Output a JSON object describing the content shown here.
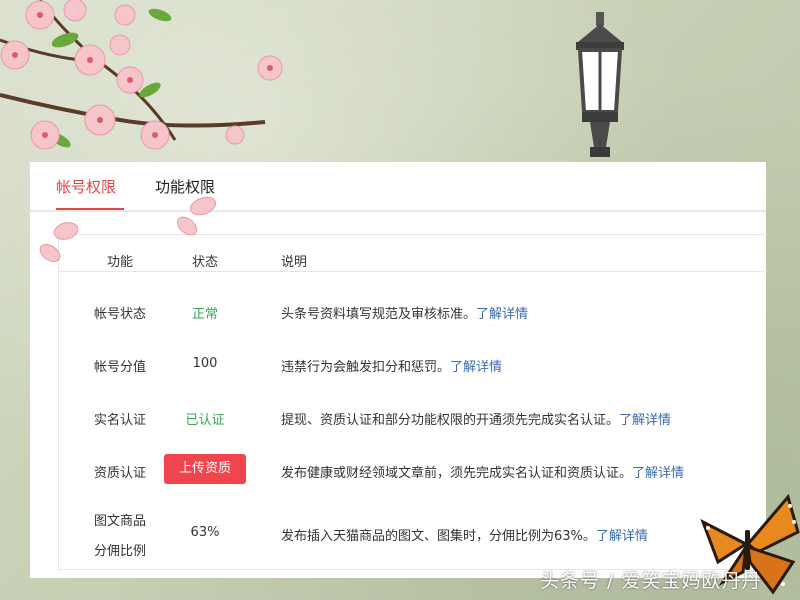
{
  "tabs": [
    {
      "label": "帐号权限",
      "active": true
    },
    {
      "label": "功能权限",
      "active": false
    }
  ],
  "table": {
    "headers": {
      "func": "功能",
      "status": "状态",
      "desc": "说明"
    },
    "rows": [
      {
        "func": "帐号状态",
        "status": "正常",
        "status_type": "ok",
        "desc": "头条号资料填写规范及审核标准。",
        "link": "了解详情"
      },
      {
        "func": "帐号分值",
        "status": "100",
        "status_type": "plain",
        "desc": "违禁行为会触发扣分和惩罚。",
        "link": "了解详情"
      },
      {
        "func": "实名认证",
        "status": "已认证",
        "status_type": "ok",
        "desc": "提现、资质认证和部分功能权限的开通须先完成实名认证。",
        "link": "了解详情"
      },
      {
        "func": "资质认证",
        "status": "上传资质",
        "status_type": "button",
        "desc": "发布健康或财经领域文章前，须先完成实名认证和资质认证。",
        "link": "了解详情"
      },
      {
        "func_line1": "图文商品",
        "func_line2": "分佣比例",
        "status": "63%",
        "status_type": "plain",
        "desc": "发布插入天猫商品的图文、图集时，分佣比例为63%。",
        "link": "了解详情"
      }
    ]
  },
  "watermark": "头条号 / 爱笑宝妈欧丹丹",
  "colors": {
    "accent": "#e54545",
    "ok": "#35a853",
    "link": "#3a6bb0",
    "button": "#f1454e"
  }
}
